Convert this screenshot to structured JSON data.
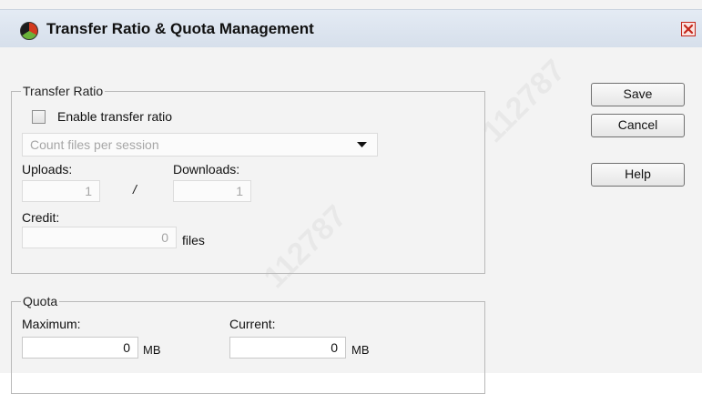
{
  "window": {
    "title": "Transfer Ratio & Quota Management"
  },
  "transfer_ratio": {
    "legend": "Transfer Ratio",
    "enable_label": "Enable transfer ratio",
    "enable_checked": false,
    "mode_select": {
      "value": "Count files per session"
    },
    "uploads_label": "Uploads:",
    "uploads_value": "1",
    "separator": "/",
    "downloads_label": "Downloads:",
    "downloads_value": "1",
    "credit_label": "Credit:",
    "credit_value": "0",
    "credit_unit": "files"
  },
  "quota": {
    "legend": "Quota",
    "maximum_label": "Maximum:",
    "maximum_value": "0",
    "maximum_unit": "MB",
    "current_label": "Current:",
    "current_value": "0",
    "current_unit": "MB"
  },
  "buttons": {
    "save": "Save",
    "cancel": "Cancel",
    "help": "Help"
  },
  "icons": {
    "title_icon": "app-logo-icon",
    "close_icon": "close-icon",
    "dropdown_icon": "chevron-down-icon"
  },
  "watermark": "112787",
  "colors": {
    "titlebar": "#d6dfeb",
    "close_accent": "#c3271b"
  }
}
